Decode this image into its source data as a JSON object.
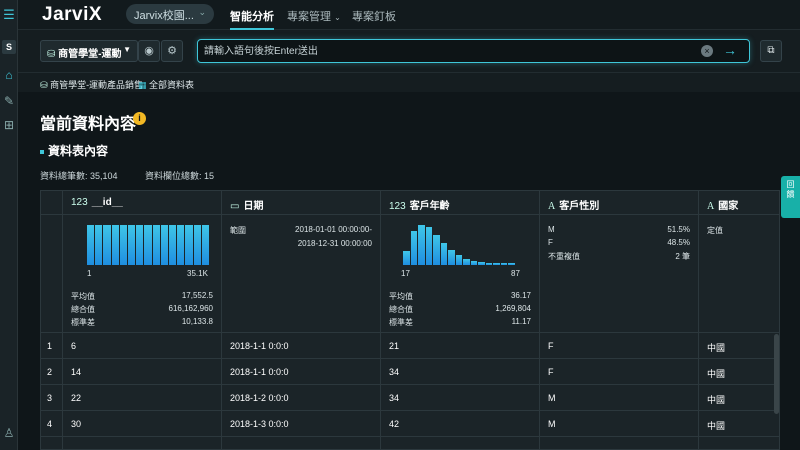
{
  "app": {
    "logo": "JarviX",
    "workspace": "Jarvix校園...",
    "nav": [
      "智能分析",
      "專案管理",
      "專案釘板"
    ]
  },
  "toolbar": {
    "dataset": "商管學堂-運動",
    "query_placeholder": "請輸入語句後按Enter送出"
  },
  "breadcrumb": {
    "dataset": "商管學堂-運動產品銷售",
    "table": "全部資料表"
  },
  "page": {
    "title": "當前資料內容",
    "section": "資料表內容",
    "total_rows": "資料總筆數: 35,104",
    "total_cols": "資料欄位總數: 15"
  },
  "right_tab": "回饋",
  "columns": [
    {
      "type": "123",
      "name": "__id__",
      "hist_min": "1",
      "hist_max": "35.1K",
      "stats": [
        [
          "平均值",
          "17,552.5"
        ],
        [
          "總合值",
          "616,162,960"
        ],
        [
          "標準差",
          "10,133.8"
        ]
      ],
      "hist": [
        1,
        1,
        1,
        1,
        1,
        1,
        1,
        1,
        1,
        1,
        1,
        1,
        1,
        1,
        1
      ]
    },
    {
      "type": "date",
      "name": "日期",
      "range_label": "範圍",
      "range_start": "2018-01-01 00:00:00-",
      "range_end": "2018-12-31 00:00:00"
    },
    {
      "type": "123",
      "name": "客戶年齡",
      "hist_min": "17",
      "hist_max": "87",
      "stats": [
        [
          "平均值",
          "36.17"
        ],
        [
          "總合值",
          "1,269,804"
        ],
        [
          "標準差",
          "11.17"
        ]
      ],
      "hist": [
        0.35,
        0.85,
        1.0,
        0.95,
        0.75,
        0.55,
        0.38,
        0.25,
        0.15,
        0.1,
        0.07,
        0.05,
        0.04,
        0.03,
        0.02
      ]
    },
    {
      "type": "A",
      "name": "客戶性別",
      "cats": [
        [
          "M",
          "51.5%"
        ],
        [
          "F",
          "48.5%"
        ],
        [
          "不重複值",
          "2 筆"
        ]
      ]
    },
    {
      "type": "A",
      "name": "國家",
      "label": "定值"
    }
  ],
  "rows": [
    {
      "n": "1",
      "id": "6",
      "date": "2018-1-1 0:0:0",
      "age": "21",
      "sex": "F",
      "country": "中國"
    },
    {
      "n": "2",
      "id": "14",
      "date": "2018-1-1 0:0:0",
      "age": "34",
      "sex": "F",
      "country": "中國"
    },
    {
      "n": "3",
      "id": "22",
      "date": "2018-1-2 0:0:0",
      "age": "34",
      "sex": "M",
      "country": "中國"
    },
    {
      "n": "4",
      "id": "30",
      "date": "2018-1-3 0:0:0",
      "age": "42",
      "sex": "M",
      "country": "中國"
    }
  ]
}
